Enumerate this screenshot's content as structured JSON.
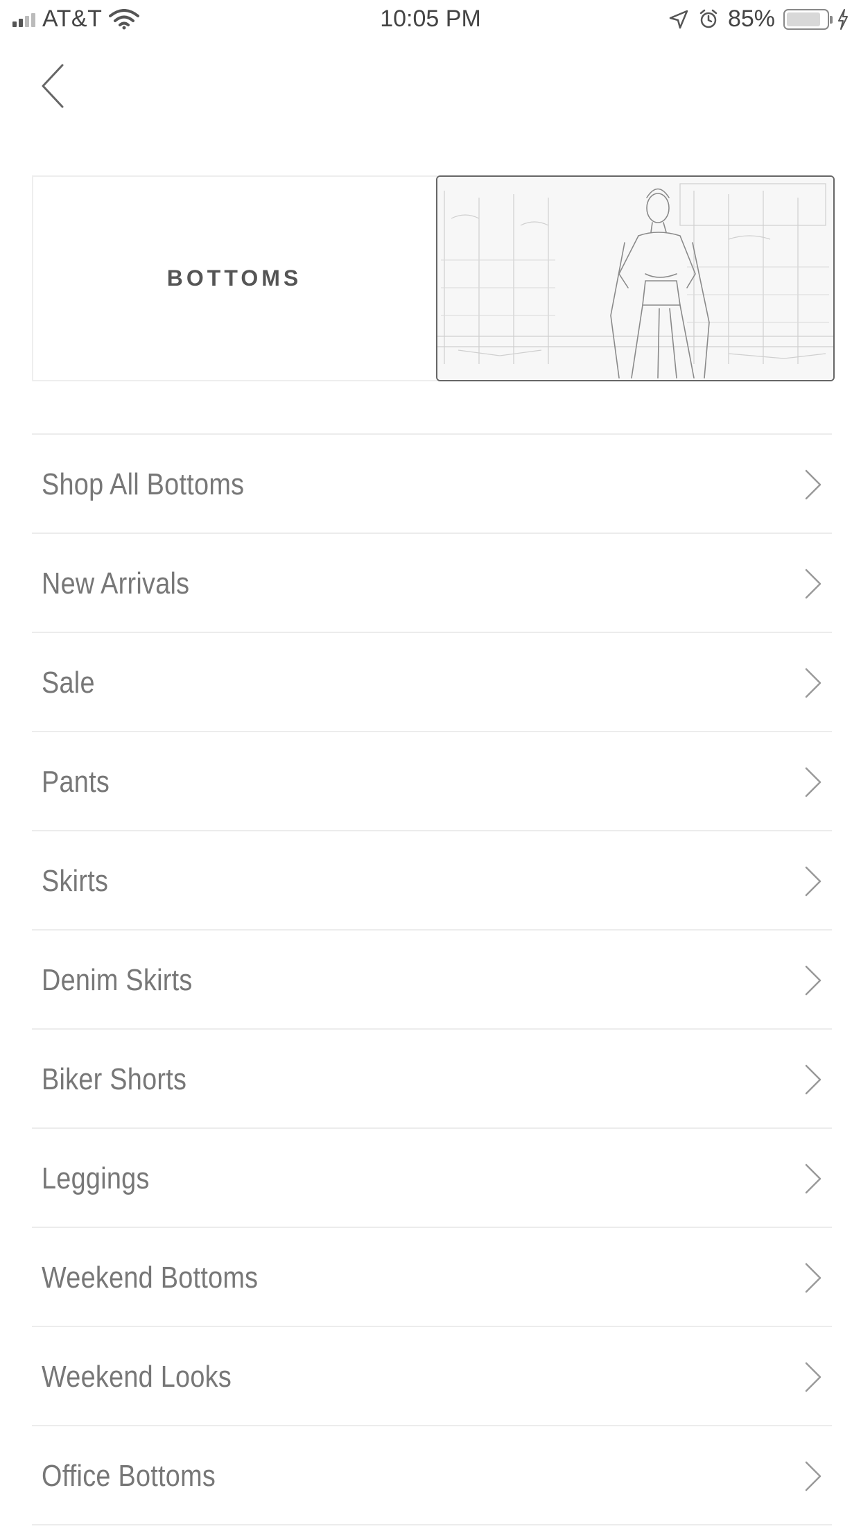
{
  "status_bar": {
    "carrier": "AT&T",
    "time": "10:05 PM",
    "battery_percent_text": "85%",
    "battery_level": 0.85,
    "icons": [
      "signal-icon",
      "wifi-icon",
      "location-arrow-icon",
      "alarm-icon",
      "battery-icon",
      "charging-bolt-icon"
    ]
  },
  "nav": {
    "back_icon": "chevron-left-icon"
  },
  "banner": {
    "title": "BOTTOMS",
    "image": "photo-woman-in-long-coat"
  },
  "menu": {
    "items": [
      {
        "label": "Shop All Bottoms"
      },
      {
        "label": "New Arrivals"
      },
      {
        "label": "Sale"
      },
      {
        "label": "Pants"
      },
      {
        "label": "Skirts"
      },
      {
        "label": "Denim Skirts"
      },
      {
        "label": "Biker Shorts"
      },
      {
        "label": "Leggings"
      },
      {
        "label": "Weekend Bottoms"
      },
      {
        "label": "Weekend Looks"
      },
      {
        "label": "Office Bottoms"
      }
    ],
    "item_icon": "chevron-right-icon"
  },
  "colors": {
    "text": "#777777",
    "divider": "#ececec",
    "background": "#ffffff"
  }
}
